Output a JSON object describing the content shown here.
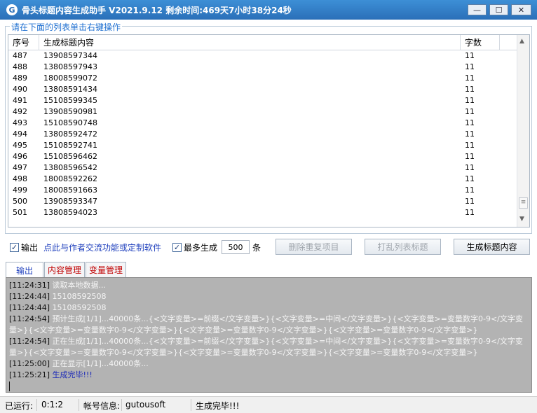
{
  "window": {
    "title": "骨头标题内容生成助手  V2021.9.12  剩余时间:469天7小时38分24秒",
    "icon_letter": "G",
    "minimize_label": "—",
    "maximize_label": "☐",
    "close_label": "✕"
  },
  "group_label": "请在下面的列表单击右键操作",
  "table": {
    "columns": [
      "序号",
      "生成标题内容",
      "字数"
    ],
    "rows": [
      [
        "487",
        "13908597344",
        "11"
      ],
      [
        "488",
        "13808597943",
        "11"
      ],
      [
        "489",
        "18008599072",
        "11"
      ],
      [
        "490",
        "13808591434",
        "11"
      ],
      [
        "491",
        "15108599345",
        "11"
      ],
      [
        "492",
        "13908590981",
        "11"
      ],
      [
        "493",
        "15108590748",
        "11"
      ],
      [
        "494",
        "13808592472",
        "11"
      ],
      [
        "495",
        "15108592741",
        "11"
      ],
      [
        "496",
        "15108596462",
        "11"
      ],
      [
        "497",
        "13808596542",
        "11"
      ],
      [
        "498",
        "18008592262",
        "11"
      ],
      [
        "499",
        "18008591663",
        "11"
      ],
      [
        "500",
        "13908593347",
        "11"
      ],
      [
        "501",
        "13808594023",
        "11"
      ]
    ]
  },
  "controls": {
    "output_checkbox_label": "输出",
    "output_checked": true,
    "contact_link": "点此与作者交流功能或定制软件",
    "max_generate_label": "最多生成",
    "max_generate_checked": true,
    "max_generate_value": "500",
    "max_generate_unit": "条",
    "dedupe_button": "删除重复项目",
    "shuffle_button": "打乱列表标题",
    "generate_button": "生成标题内容"
  },
  "tabs": [
    "输出",
    "内容管理",
    "变量管理"
  ],
  "log": [
    {
      "time": "[11:24:31]",
      "msg": "读取本地数据..."
    },
    {
      "time": "[11:24:44]",
      "msg": "15108592508"
    },
    {
      "time": "[11:24:44]",
      "msg": "15108592508"
    },
    {
      "time": "[11:24:54]",
      "msg": "预计生成[1/1]...40000条...{<文字变量>=前缀</文字变量>}{<文字变量>=中间</文字变量>}{<文字变量>=变量数字0-9</文字变量>}{<文字变量>=变量数字0-9</文字变量>}{<文字变量>=变量数字0-9</文字变量>}{<文字变量>=变量数字0-9</文字变量>}"
    },
    {
      "time": "[11:24:54]",
      "msg": "正在生成[1/1]...40000条...{<文字变量>=前缀</文字变量>}{<文字变量>=中间</文字变量>}{<文字变量>=变量数字0-9</文字变量>}{<文字变量>=变量数字0-9</文字变量>}{<文字变量>=变量数字0-9</文字变量>}{<文字变量>=变量数字0-9</文字变量>}"
    },
    {
      "time": "[11:25:00]",
      "msg": "正在显示[1/1]...40000条..."
    },
    {
      "time": "[11:25:21]",
      "msg": "生成完毕!!!"
    }
  ],
  "statusbar": {
    "runtime_label": "已运行:",
    "runtime_value": "0:1:2",
    "account_label": "帐号信息:",
    "account_value": "gutousoft",
    "status_text": "生成完毕!!!"
  },
  "colors": {
    "titlebar": "#2a6fb8",
    "accent_blue": "#1e3fbd",
    "tab_red": "#c00000",
    "log_bg": "#b3b3b3"
  }
}
